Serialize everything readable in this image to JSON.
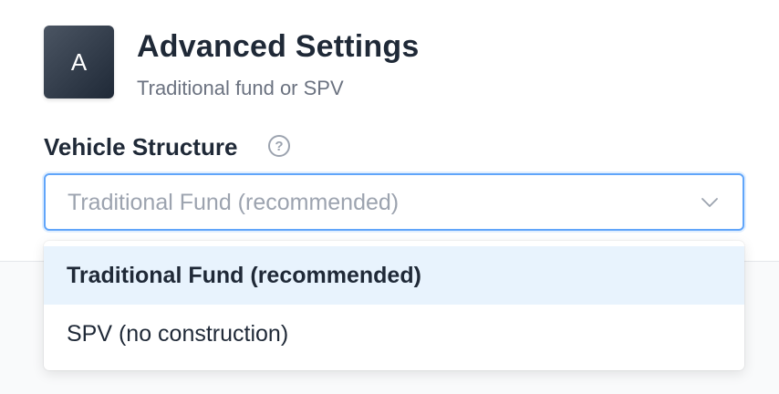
{
  "header": {
    "avatar_letter": "A",
    "title": "Advanced Settings",
    "subtitle": "Traditional fund or SPV"
  },
  "field": {
    "label": "Vehicle Structure",
    "help_icon": "question-circle-icon",
    "selected_value": "Traditional Fund (recommended)",
    "chevron_icon": "chevron-down-icon"
  },
  "dropdown": {
    "options": [
      {
        "label": "Traditional Fund (recommended)",
        "selected": true
      },
      {
        "label": "SPV (no construction)",
        "selected": false
      }
    ]
  },
  "colors": {
    "focus_border": "#60a5fa",
    "selected_option_bg": "#e8f3fd",
    "text_primary": "#1f2937",
    "text_muted": "#6b7280"
  }
}
